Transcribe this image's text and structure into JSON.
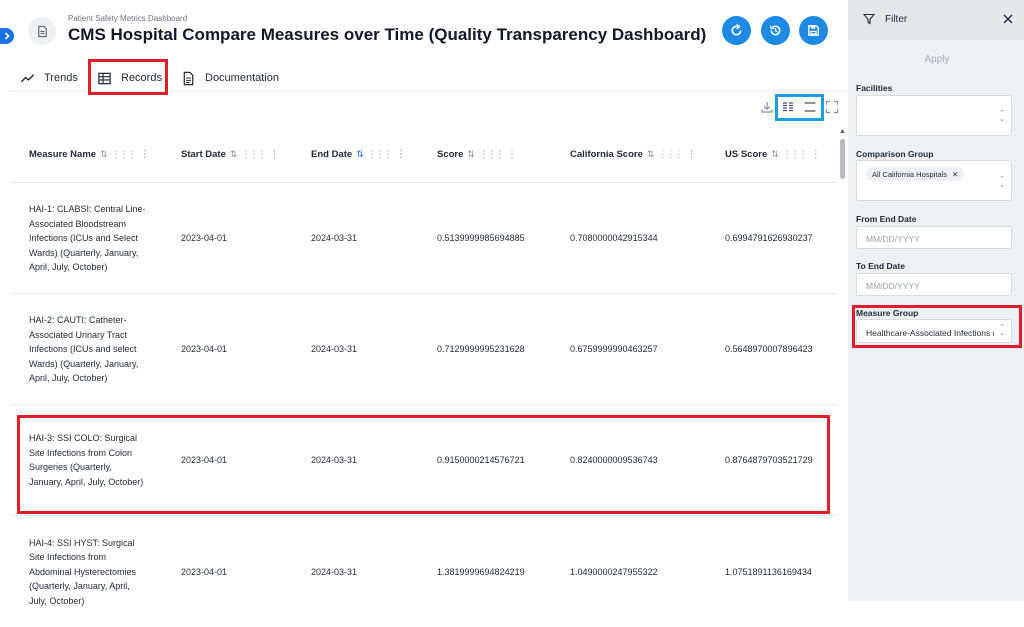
{
  "header": {
    "subtitle": "Patient Safety Metrics Dashboard",
    "title": "CMS Hospital Compare Measures over Time (Quality Transparency Dashboard)"
  },
  "tabs": [
    {
      "label": "Trends"
    },
    {
      "label": "Records"
    },
    {
      "label": "Documentation"
    }
  ],
  "table": {
    "columns": [
      "Measure Name",
      "Start Date",
      "End Date",
      "Score",
      "California Score",
      "US Score"
    ],
    "rows": [
      {
        "name": "HAI-1: CLABSI: Central Line-Associated Bloodstream Infections (ICUs and Select Wards) (Quarterly, January, April, July, October)",
        "start": "2023-04-01",
        "end": "2024-03-31",
        "score": "0.5139999985694885",
        "ca": "0.7080000042915344",
        "us": "0.6994791626930237"
      },
      {
        "name": "HAI-2: CAUTI: Catheter-Associated Urinary Tract Infections (ICUs and select Wards) (Quarterly, January, April, July, October)",
        "start": "2023-04-01",
        "end": "2024-03-31",
        "score": "0.7129999995231628",
        "ca": "0.6759999990463257",
        "us": "0.5648970007896423"
      },
      {
        "name": "HAI-3: SSI COLO: Surgical Site Infections from Colon Surgeries (Quarterly, January, April, July, October)",
        "start": "2023-04-01",
        "end": "2024-03-31",
        "score": "0.9150000214576721",
        "ca": "0.8240000009536743",
        "us": "0.8764879703521729"
      },
      {
        "name": "HAI-4: SSI HYST: Surgical Site Infections from Abdominal Hysterectomies (Quarterly, January, April, July, October)",
        "start": "2023-04-01",
        "end": "2024-03-31",
        "score": "1.3819999694824219",
        "ca": "1.0490000247955322",
        "us": "1.0751891136169434"
      }
    ]
  },
  "filter": {
    "title": "Filter",
    "apply_label": "Apply",
    "facilities_label": "Facilities",
    "comparison_label": "Comparison Group",
    "comparison_chip": "All California Hospitals",
    "from_end_label": "From End Date",
    "from_end_placeholder": "MM/DD/YYYY",
    "to_end_label": "To End Date",
    "to_end_placeholder": "MM/DD/YYYY",
    "measure_group_label": "Measure Group",
    "measure_group_value": "Healthcare-Associated Infections (HAI)"
  },
  "colors": {
    "accent": "#1f8ae6",
    "highlight_red": "#e11d2a",
    "highlight_blue": "#1ba1e2",
    "panel_bg": "#eef0f3"
  }
}
